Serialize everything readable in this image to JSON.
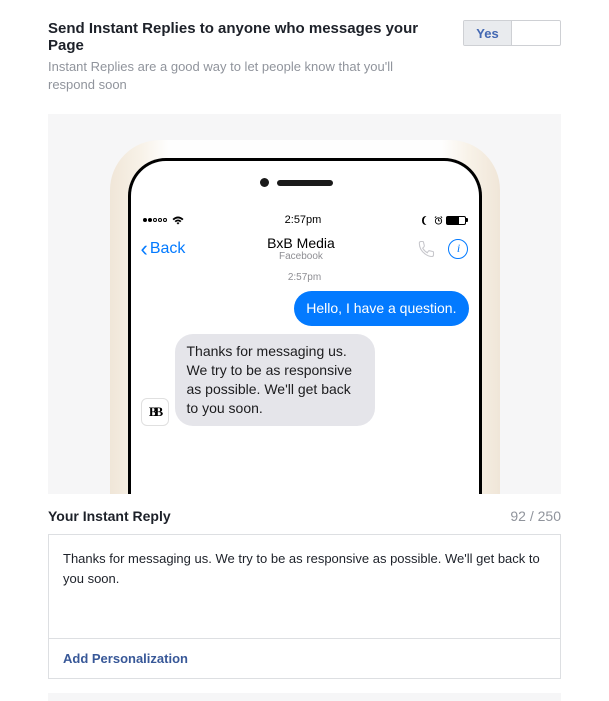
{
  "header": {
    "title": "Send Instant Replies to anyone who messages your Page",
    "subtitle": "Instant Replies are a good way to let people know that you'll respond soon",
    "toggle_yes": "Yes",
    "toggle_no": ""
  },
  "phone": {
    "status_time": "2:57pm",
    "back_label": "Back",
    "nav_title": "BxB Media",
    "nav_subtitle": "Facebook",
    "chat_time": "2:57pm",
    "user_message": "Hello, I have a question.",
    "reply_message": "Thanks for messaging us. We try to be as responsive as possible. We'll get back to you soon.",
    "avatar_text": "BB"
  },
  "reply": {
    "title": "Your Instant Reply",
    "counter": "92 / 250",
    "text": "Thanks for messaging us. We try to be as responsive as possible. We'll get back to you soon.",
    "personalization_label": "Add Personalization"
  }
}
